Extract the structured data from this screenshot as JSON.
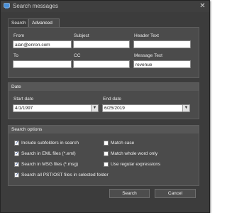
{
  "window": {
    "title": "Search messages",
    "close_glyph": "✕",
    "app_icon": "search-app-icon"
  },
  "tabs": [
    {
      "label": "Search",
      "active": false
    },
    {
      "label": "Advanced",
      "active": true
    }
  ],
  "advanced": {
    "from_label": "From",
    "from_value": "alan@enron.com",
    "subject_label": "Subject",
    "subject_value": "",
    "header_label": "Header Text",
    "header_value": "",
    "to_label": "To",
    "to_value": "",
    "cc_label": "CC",
    "cc_value": "",
    "message_label": "Message Text",
    "message_value": "revenue"
  },
  "date": {
    "section_title": "Date",
    "start_label": "Start date",
    "start_value": "4/1/1997",
    "end_label": "End date",
    "end_value": "6/25/2019",
    "dropdown_glyph": "▼"
  },
  "options": {
    "section_title": "Search options",
    "check_glyph": "✓",
    "items": [
      {
        "label": "Include subfolders in search",
        "checked": true
      },
      {
        "label": "Search in EML files (*.eml)",
        "checked": true
      },
      {
        "label": "Search in MSG files (*.msg)",
        "checked": true
      },
      {
        "label": "Search all PST/OST files in selected folder",
        "checked": true
      },
      {
        "label": "Match case",
        "checked": false
      },
      {
        "label": "Match whole word only",
        "checked": false
      },
      {
        "label": "Use regular expressions",
        "checked": false
      }
    ]
  },
  "buttons": {
    "search": "Search",
    "cancel": "Cancel"
  }
}
